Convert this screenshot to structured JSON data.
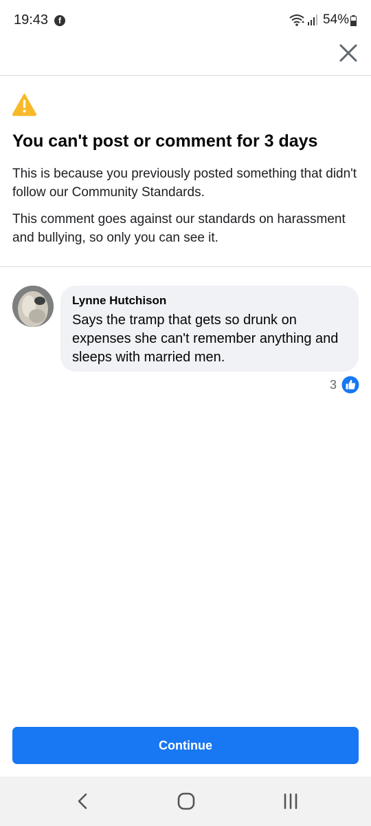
{
  "status_bar": {
    "time": "19:43",
    "app_icon": "facebook-icon",
    "battery": "54%"
  },
  "header": {
    "close_icon": "close-icon"
  },
  "notice": {
    "icon": "warning-icon",
    "title": "You can't post or comment for 3 days",
    "body_1": "This is because you previously posted something that didn't follow our Community Standards.",
    "body_2": "This comment goes against our standards on harassment and bullying, so only you can see it."
  },
  "comment": {
    "author": "Lynne Hutchison",
    "text": "Says the tramp that gets so drunk on expenses she can't remember anything and sleeps with married men.",
    "reaction_count": "3",
    "reaction_icon": "like-icon"
  },
  "actions": {
    "continue_label": "Continue"
  },
  "colors": {
    "primary": "#1877f2",
    "warning": "#f7b928",
    "bubble": "#f0f2f5"
  }
}
